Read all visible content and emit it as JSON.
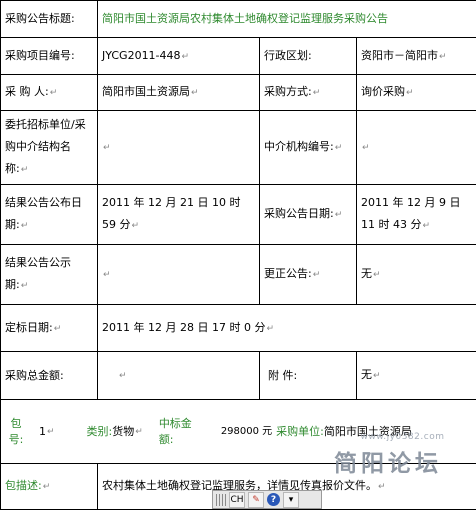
{
  "notice": {
    "title_label": "采购公告标题:",
    "title_value": "简阳市国土资源局农村集体土地确权登记监理服务采购公告",
    "rows": [
      {
        "l1": "采购项目编号:",
        "v1": "JYCG2011-448",
        "l2": "行政区划:",
        "v2": "资阳市－简阳市"
      },
      {
        "l1": "采 购 人:",
        "v1": "简阳市国土资源局",
        "l2": "采购方式:",
        "v2": "询价采购"
      },
      {
        "l1": "委托招标单位/采购中介结构名称:",
        "v1": "",
        "l2": "中介机构编号:",
        "v2": ""
      },
      {
        "l1": "结果公告公布日期:",
        "v1": "2011 年 12 月 21 日 10 时 59 分",
        "l2": "采购公告日期:",
        "v2": "2011 年 12 月 9 日 11 时 43 分"
      },
      {
        "l1": "结果公告公示期:",
        "v1": "",
        "l2": "更正公告:",
        "v2": "无"
      },
      {
        "l1": "定标日期:",
        "v1": "2011 年 12 月 28 日 17 时 0 分"
      },
      {
        "l1": "采购总金额:",
        "v1": "",
        "l2": "附 件:",
        "v2": "无"
      }
    ],
    "package": {
      "pkg_label": "包号:",
      "pkg_value": "1",
      "category_label": "类别:",
      "category_value": "货物",
      "amount_label": "中标金额:",
      "amount_value": "298000 元",
      "unit_label": "采购单位:",
      "unit_value": "简阳市国土资源局"
    },
    "desc_label": "包描述:",
    "desc_value": "农村集体土地确权登记监理服务，详情见传真报价文件。"
  },
  "watermark": {
    "site": "www.jy0382.com",
    "logo": "简阳论坛"
  },
  "ime": {
    "lang": "CH",
    "help": "?"
  }
}
